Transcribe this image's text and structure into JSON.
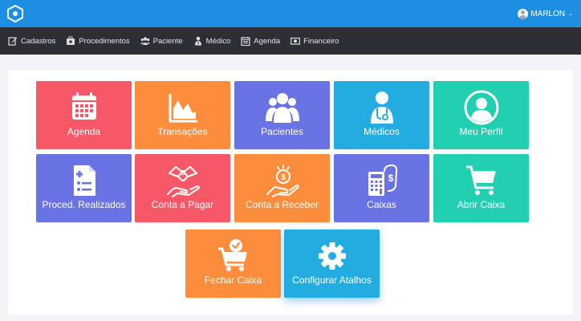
{
  "header": {
    "user_name": "MARLON",
    "caret": "⌄"
  },
  "nav": {
    "items": [
      {
        "label": "Cadastros",
        "icon": "edit-icon"
      },
      {
        "label": "Procedimentos",
        "icon": "medical-kit-icon"
      },
      {
        "label": "Paciente",
        "icon": "users-icon"
      },
      {
        "label": "Médico",
        "icon": "doctor-icon"
      },
      {
        "label": "Agenda",
        "icon": "calendar-icon"
      },
      {
        "label": "Financeiro",
        "icon": "money-icon"
      }
    ]
  },
  "tiles": [
    {
      "label": "Agenda",
      "icon": "calendar-icon",
      "color": "#f65868"
    },
    {
      "label": "Transações",
      "icon": "area-chart-icon",
      "color": "#fb8d3d"
    },
    {
      "label": "Pacientes",
      "icon": "users-icon",
      "color": "#6a73e3"
    },
    {
      "label": "Médicos",
      "icon": "doctor-icon",
      "color": "#22ace0"
    },
    {
      "label": "Meu Perfil",
      "icon": "user-circle-icon",
      "color": "#22cfb0"
    },
    {
      "label": "Proced. Realizados",
      "icon": "medical-document-icon",
      "color": "#6a73e3"
    },
    {
      "label": "Conta a Pagar",
      "icon": "pay-hand-icon",
      "color": "#f65868"
    },
    {
      "label": "Conta a Receber",
      "icon": "receive-money-icon",
      "color": "#fb8d3d"
    },
    {
      "label": "Caixas",
      "icon": "calculator-money-icon",
      "color": "#6a73e3"
    },
    {
      "label": "Abrir Caixa",
      "icon": "cart-icon",
      "color": "#22cfb0"
    },
    {
      "label": "Fechar Caixa",
      "icon": "cart-check-icon",
      "color": "#fb8d3d"
    },
    {
      "label": "Configurar Atalhos",
      "icon": "gear-icon",
      "color": "#22ace0"
    }
  ]
}
